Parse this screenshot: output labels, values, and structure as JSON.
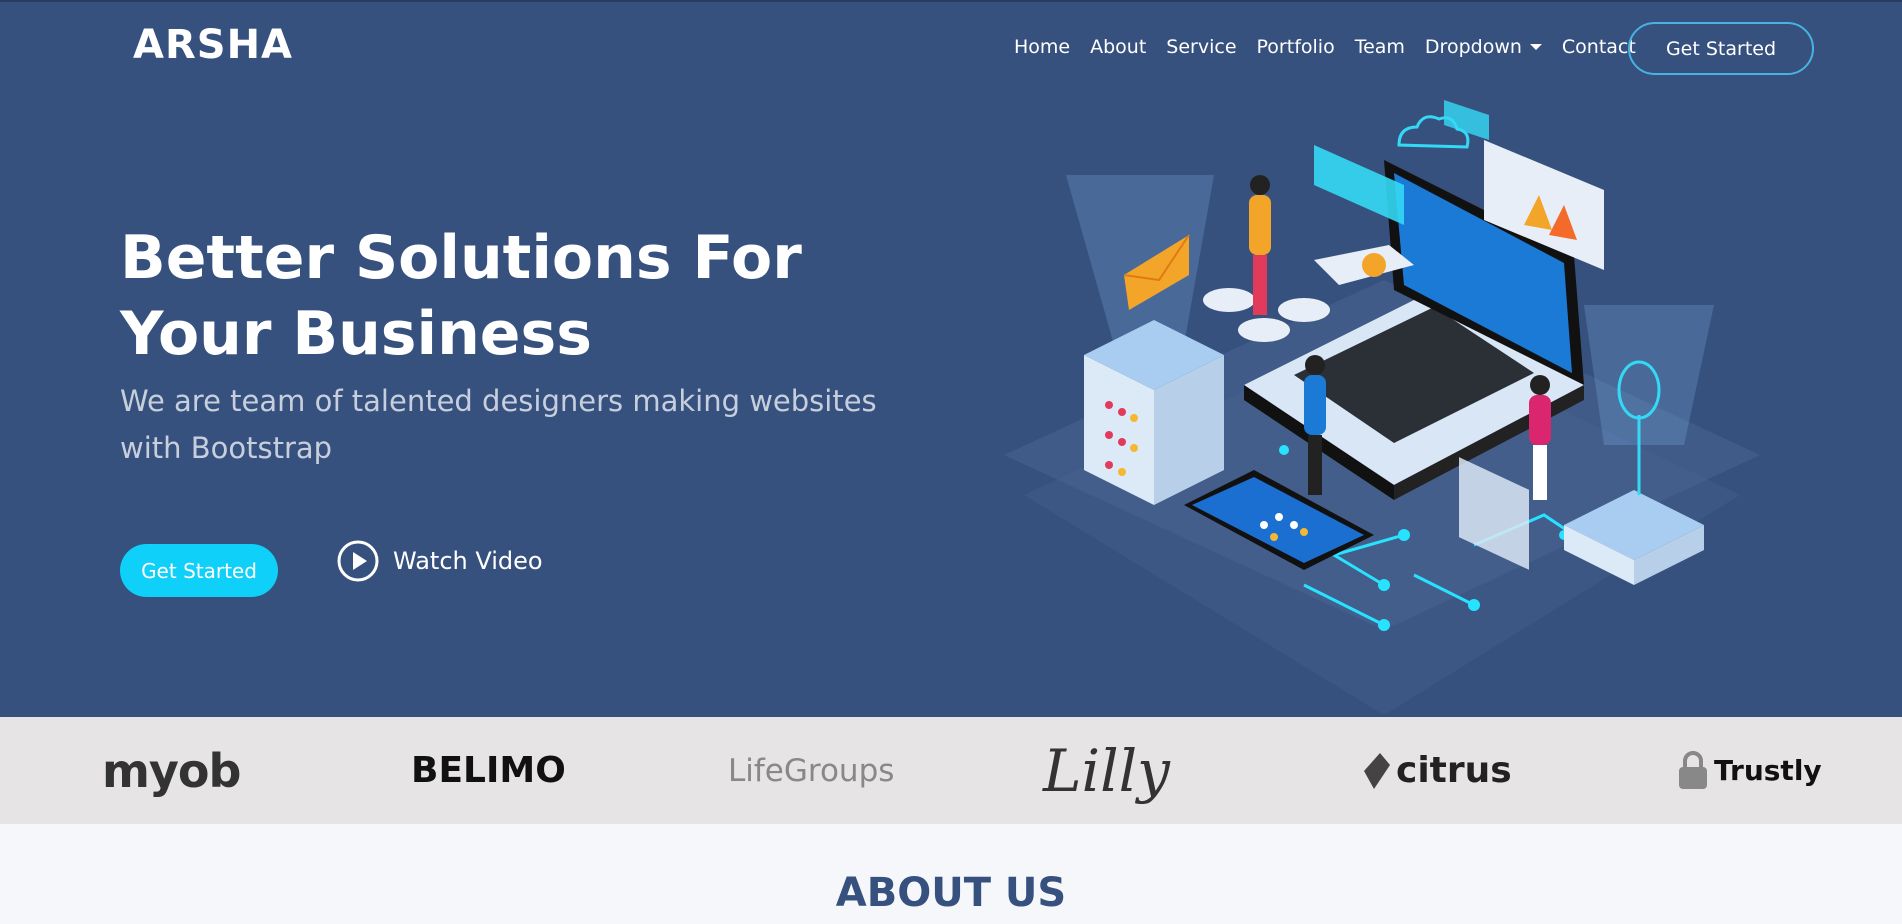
{
  "brand": {
    "name": "ARSHA"
  },
  "nav": {
    "items": [
      {
        "label": "Home"
      },
      {
        "label": "About"
      },
      {
        "label": "Service"
      },
      {
        "label": "Portfolio"
      },
      {
        "label": "Team"
      },
      {
        "label": "Dropdown"
      },
      {
        "label": "Contact"
      }
    ],
    "cta_label": "Get Started"
  },
  "hero": {
    "title": "Better Solutions For Your Business",
    "subtitle": "We are team of talented designers making websites with Bootstrap",
    "primary_button": "Get Started",
    "video_label": "Watch Video"
  },
  "clients": [
    {
      "name": "myob"
    },
    {
      "name": "BELIMO"
    },
    {
      "name": "LifeGroups"
    },
    {
      "name": "Lilly"
    },
    {
      "name": "citrus"
    },
    {
      "name": "Trustly"
    }
  ],
  "about": {
    "title": "ABOUT US"
  },
  "colors": {
    "hero_bg": "#37517e",
    "accent": "#0fd0f8",
    "outline": "#47b2e4",
    "clients_bg": "#e6e4e4"
  },
  "icons": {
    "play": "play-circle-icon",
    "caret": "caret-down-icon"
  }
}
